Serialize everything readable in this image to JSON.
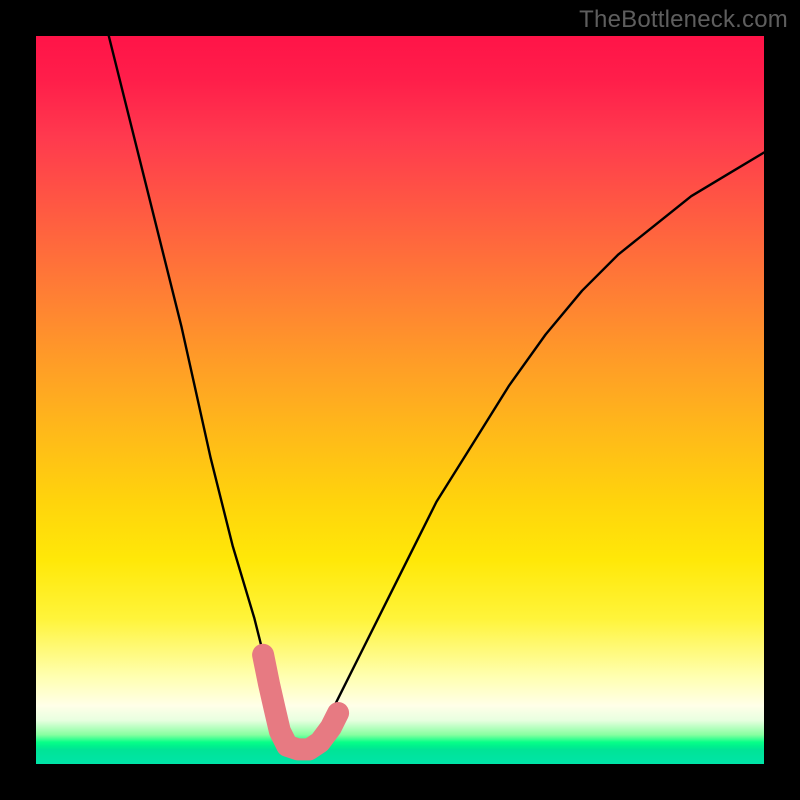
{
  "watermark": "TheBottleneck.com",
  "chart_data": {
    "type": "line",
    "title": "",
    "xlabel": "",
    "ylabel": "",
    "xlim": [
      0,
      100
    ],
    "ylim": [
      0,
      100
    ],
    "grid": false,
    "legend": false,
    "series": [
      {
        "name": "bottleneck-curve",
        "x": [
          10,
          15,
          20,
          24,
          27,
          30,
          32,
          33.5,
          35,
          37,
          40,
          45,
          50,
          55,
          60,
          65,
          70,
          75,
          80,
          85,
          90,
          95,
          100
        ],
        "values": [
          100,
          80,
          60,
          42,
          30,
          20,
          12,
          6,
          2,
          2,
          6,
          16,
          26,
          36,
          44,
          52,
          59,
          65,
          70,
          74,
          78,
          81,
          84
        ]
      }
    ],
    "markers": {
      "name": "highlight-range",
      "color": "#e77a82",
      "style": "rounded-segment",
      "points": [
        {
          "x": 31.2,
          "y": 15
        },
        {
          "x": 32.0,
          "y": 11
        },
        {
          "x": 32.8,
          "y": 7.5
        },
        {
          "x": 33.5,
          "y": 4.5
        },
        {
          "x": 34.5,
          "y": 2.5
        },
        {
          "x": 36.0,
          "y": 2.0
        },
        {
          "x": 37.5,
          "y": 2.0
        },
        {
          "x": 39.0,
          "y": 3.0
        },
        {
          "x": 40.5,
          "y": 5.0
        },
        {
          "x": 41.5,
          "y": 7.0
        }
      ]
    },
    "background_gradient": {
      "top": "#ff1448",
      "mid": "#ffd000",
      "bottom": "#00e49a"
    }
  }
}
